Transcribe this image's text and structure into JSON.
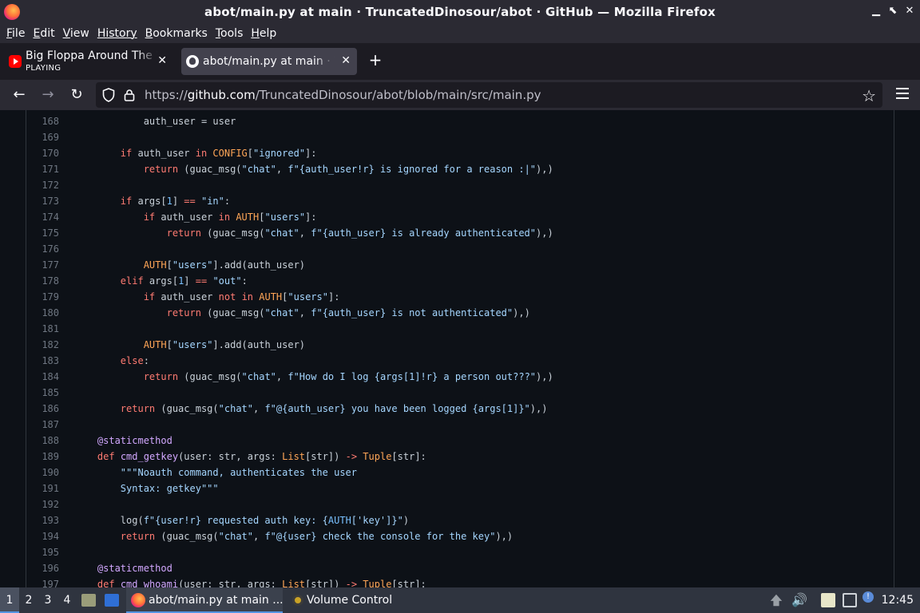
{
  "window": {
    "title": "abot/main.py at main · TruncatedDinosour/abot · GitHub — Mozilla Firefox",
    "controls": [
      "▁",
      "⬉",
      "✕"
    ]
  },
  "menu": [
    {
      "label": "File",
      "u": "F",
      "rest": "ile"
    },
    {
      "label": "Edit",
      "u": "E",
      "rest": "dit"
    },
    {
      "label": "View",
      "u": "V",
      "rest": "iew"
    },
    {
      "label": "History",
      "u": "",
      "rest": "History"
    },
    {
      "label": "Bookmarks",
      "u": "B",
      "rest": "ookmarks"
    },
    {
      "label": "Tools",
      "u": "T",
      "rest": "ools"
    },
    {
      "label": "Help",
      "u": "H",
      "rest": "elp"
    }
  ],
  "tabs": [
    {
      "label": "Big Floppa Around The World",
      "sub": "PLAYING",
      "icon": "youtube-icon"
    },
    {
      "label": "abot/main.py at main · TruncatedDinosour/abot",
      "icon": "github-icon"
    }
  ],
  "newtab": "+",
  "nav": {
    "back": "←",
    "forward": "→",
    "reload": "↻",
    "url_proto": "https://",
    "url_host": "github.com",
    "url_path": "/TruncatedDinosour/abot/blob/main/src/main.py",
    "star": "☆"
  },
  "code": {
    "lines": [
      {
        "n": "168",
        "html": "            auth_user = user"
      },
      {
        "n": "169",
        "html": ""
      },
      {
        "n": "170",
        "html": "        <span class=\"kw\">if</span> auth_user <span class=\"kw\">in</span> <span class=\"cn\">CONFIG</span>[<span class=\"str\">\"ignored\"</span>]:"
      },
      {
        "n": "171",
        "html": "            <span class=\"kw\">return</span> (guac_msg(<span class=\"str\">\"chat\"</span>, <span class=\"str\">f\"{auth_user!r} is ignored for a reason :|\"</span>),)"
      },
      {
        "n": "172",
        "html": ""
      },
      {
        "n": "173",
        "html": "        <span class=\"kw\">if</span> args[<span class=\"bi\">1</span>] <span class=\"kw\">==</span> <span class=\"str\">\"in\"</span>:"
      },
      {
        "n": "174",
        "html": "            <span class=\"kw\">if</span> auth_user <span class=\"kw\">in</span> <span class=\"cn\">AUTH</span>[<span class=\"str\">\"users\"</span>]:"
      },
      {
        "n": "175",
        "html": "                <span class=\"kw\">return</span> (guac_msg(<span class=\"str\">\"chat\"</span>, <span class=\"str\">f\"{auth_user} is already authenticated\"</span>),)"
      },
      {
        "n": "176",
        "html": ""
      },
      {
        "n": "177",
        "html": "            <span class=\"cn\">AUTH</span>[<span class=\"str\">\"users\"</span>].add(auth_user)"
      },
      {
        "n": "178",
        "html": "        <span class=\"kw\">elif</span> args[<span class=\"bi\">1</span>] <span class=\"kw\">==</span> <span class=\"str\">\"out\"</span>:"
      },
      {
        "n": "179",
        "html": "            <span class=\"kw\">if</span> auth_user <span class=\"kw\">not</span> <span class=\"kw\">in</span> <span class=\"cn\">AUTH</span>[<span class=\"str\">\"users\"</span>]:"
      },
      {
        "n": "180",
        "html": "                <span class=\"kw\">return</span> (guac_msg(<span class=\"str\">\"chat\"</span>, <span class=\"str\">f\"{auth_user} is not authenticated\"</span>),)"
      },
      {
        "n": "181",
        "html": ""
      },
      {
        "n": "182",
        "html": "            <span class=\"cn\">AUTH</span>[<span class=\"str\">\"users\"</span>].add(auth_user)"
      },
      {
        "n": "183",
        "html": "        <span class=\"kw\">else</span>:"
      },
      {
        "n": "184",
        "html": "            <span class=\"kw\">return</span> (guac_msg(<span class=\"str\">\"chat\"</span>, <span class=\"str\">f\"How do I log {args[1]!r} a person out???\"</span>),)"
      },
      {
        "n": "185",
        "html": ""
      },
      {
        "n": "186",
        "html": "        <span class=\"kw\">return</span> (guac_msg(<span class=\"str\">\"chat\"</span>, <span class=\"str\">f\"@{auth_user} you have been logged {args[1]}\"</span>),)"
      },
      {
        "n": "187",
        "html": ""
      },
      {
        "n": "188",
        "html": "    <span class=\"dc\">@staticmethod</span>"
      },
      {
        "n": "189",
        "html": "    <span class=\"kw\">def</span> <span class=\"dc\">cmd_getkey</span>(user: str, args: <span class=\"cn\">List</span>[str]) <span class=\"kw\">-&gt;</span> <span class=\"cn\">Tuple</span>[str]:"
      },
      {
        "n": "190",
        "html": "        <span class=\"str\">\"\"\"Noauth command, authenticates the user</span>"
      },
      {
        "n": "191",
        "html": "<span class=\"str\">        Syntax: getkey\"\"\"</span>"
      },
      {
        "n": "192",
        "html": ""
      },
      {
        "n": "193",
        "html": "        log(<span class=\"str\">f\"{user!r} requested auth key: {</span><span class=\"bi\">AUTH</span><span class=\"str\">['key']}\"</span>)"
      },
      {
        "n": "194",
        "html": "        <span class=\"kw\">return</span> (guac_msg(<span class=\"str\">\"chat\"</span>, <span class=\"str\">f\"@{user} check the console for the key\"</span>),)"
      },
      {
        "n": "195",
        "html": ""
      },
      {
        "n": "196",
        "html": "    <span class=\"dc\">@staticmethod</span>"
      },
      {
        "n": "197",
        "html": "    <span class=\"kw\">def</span> <span class=\"dc\">cmd_whoami</span>(user: str, args: <span class=\"cn\">List</span>[str]) <span class=\"kw\">-&gt;</span> <span class=\"cn\">Tuple</span>[str]:"
      }
    ]
  },
  "taskbar": {
    "workspaces": [
      "1",
      "2",
      "3",
      "4"
    ],
    "tasks": [
      {
        "label": "abot/main.py at main ...",
        "icon": "firefox-icon"
      },
      {
        "label": "Volume Control",
        "icon": "volume-control-icon"
      }
    ],
    "clock": "12:45"
  },
  "colors": {
    "keyword": "#ff7b72",
    "constant": "#ffa657",
    "string": "#a5d6ff",
    "decorator": "#d2a8ff",
    "accent": "#5294e2"
  }
}
